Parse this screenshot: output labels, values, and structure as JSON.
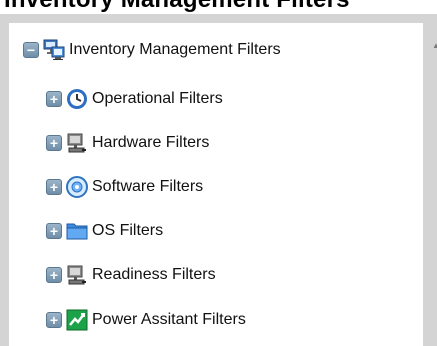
{
  "header": {
    "title": "Inventory Management Filters"
  },
  "tree": {
    "root": {
      "label": "Inventory Management Filters",
      "expander": "−",
      "icon": "network-computers-icon"
    },
    "children": [
      {
        "label": "Operational Filters",
        "expander": "+",
        "icon": "clock-icon"
      },
      {
        "label": "Hardware Filters",
        "expander": "+",
        "icon": "computer-icon"
      },
      {
        "label": "Software Filters",
        "expander": "+",
        "icon": "disc-icon"
      },
      {
        "label": "OS Filters",
        "expander": "+",
        "icon": "folder-icon"
      },
      {
        "label": "Readiness Filters",
        "expander": "+",
        "icon": "computer-icon"
      },
      {
        "label": "Power Assitant Filters",
        "expander": "+",
        "icon": "power-graph-icon"
      }
    ]
  },
  "colors": {
    "frame": "#d4d4d4",
    "expander": "#7b97ae",
    "text": "#111111"
  }
}
